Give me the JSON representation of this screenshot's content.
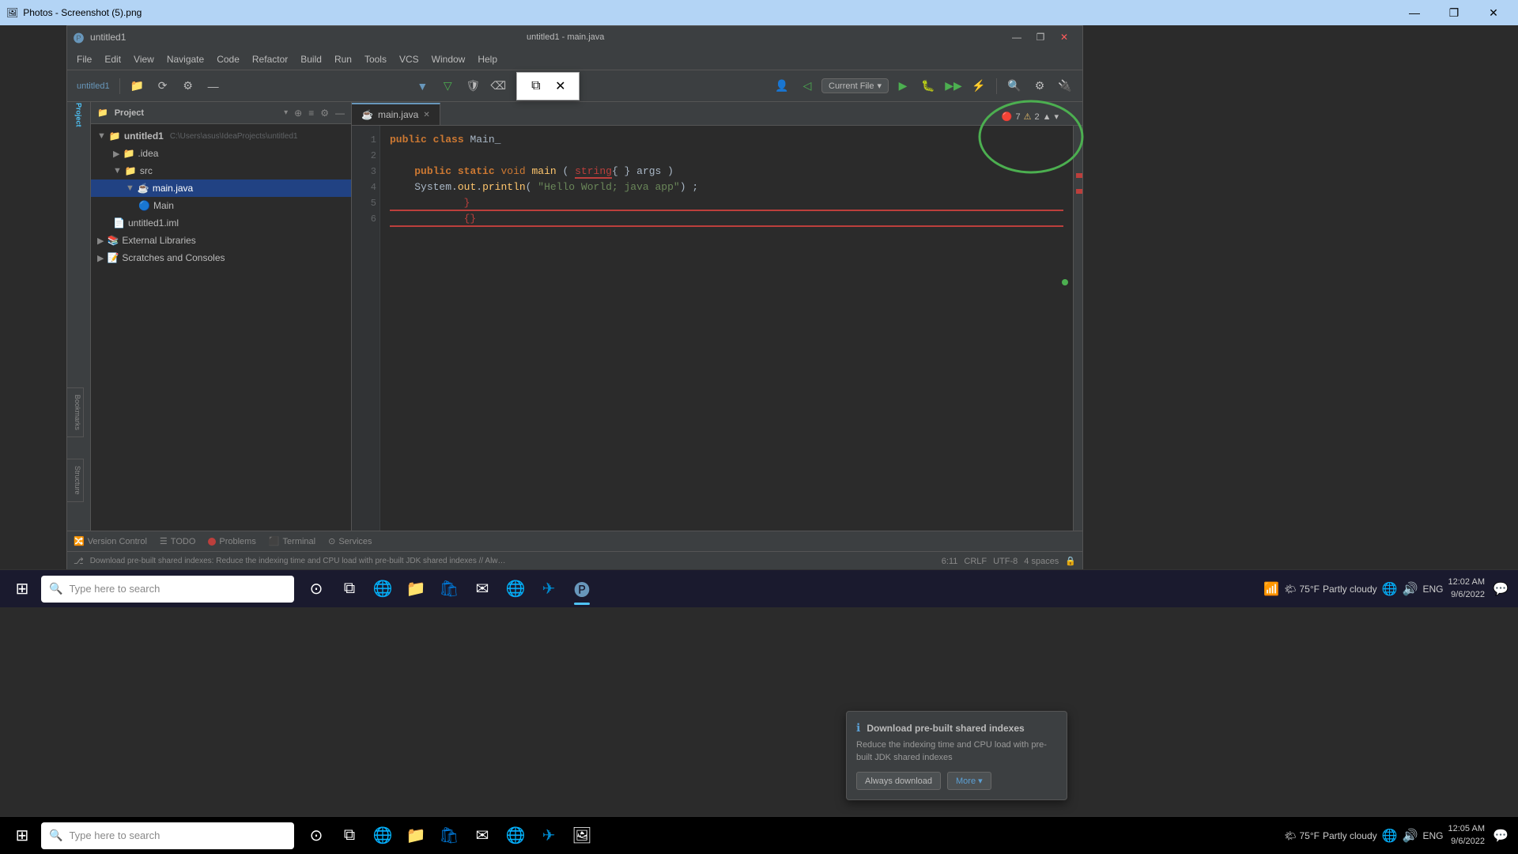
{
  "window": {
    "title": "Photos - Screenshot (5).png",
    "min_btn": "—",
    "max_btn": "❐",
    "close_btn": "✕"
  },
  "ide": {
    "title": "untitled1 - main.java",
    "menu": [
      "File",
      "Edit",
      "View",
      "Navigate",
      "Code",
      "Refactor",
      "Build",
      "Run",
      "Tools",
      "VCS",
      "Window",
      "Help"
    ],
    "project_name": "untitled1",
    "project_path": "C:\\Users\\asus\\IdeaProjects\\untitled1",
    "run_config": "Current File",
    "tab": {
      "name": "main.java",
      "icon": "☕"
    },
    "code_lines": [
      "public class Main_",
      "",
      "    public static void main ( string{ } args )",
      "    System.out.println( \"Hello World; java app\") ;",
      "            }",
      "            {}"
    ],
    "errors": "7",
    "warnings": "2",
    "status": {
      "version_control": "Version Control",
      "todo": "TODO",
      "problems": "Problems",
      "terminal": "Terminal",
      "services": "Services",
      "position": "6:11",
      "line_ending": "CRLF",
      "encoding": "UTF-8",
      "indent": "4 spaces"
    },
    "status_msg": "Download pre-built shared indexes: Reduce the indexing time and CPU load with pre-built JDK shared indexes // Always download // Download once // Don't show again // Configure...",
    "notification": {
      "title": "Download pre-built shared indexes",
      "body": "Reduce the indexing time and CPU load with pre-built JDK shared indexes",
      "btn1": "Always download",
      "btn2": "More ▾"
    }
  },
  "project_tree": [
    {
      "level": 0,
      "label": "Project",
      "icon": "📁",
      "type": "header"
    },
    {
      "level": 0,
      "label": "untitled1",
      "icon": "📁",
      "type": "project",
      "path": "C:\\Users\\asus\\IdeaProjects\\untitled1"
    },
    {
      "level": 1,
      "label": ".idea",
      "icon": "📁",
      "type": "folder"
    },
    {
      "level": 1,
      "label": "src",
      "icon": "📁",
      "type": "folder"
    },
    {
      "level": 2,
      "label": "main.java",
      "icon": "☕",
      "type": "java"
    },
    {
      "level": 3,
      "label": "Main",
      "icon": "🔵",
      "type": "class"
    },
    {
      "level": 1,
      "label": "untitled1.iml",
      "icon": "📄",
      "type": "iml"
    },
    {
      "level": 0,
      "label": "External Libraries",
      "icon": "📚",
      "type": "folder"
    },
    {
      "level": 0,
      "label": "Scratches and Consoles",
      "icon": "📝",
      "type": "folder"
    }
  ],
  "taskbar": {
    "search_placeholder": "Type here to search",
    "weather": "75°F  Partly cloudy",
    "language": "ENG",
    "time": "12:02 AM",
    "date": "9/6/2022"
  },
  "taskbar2": {
    "search_placeholder": "Type here to search",
    "weather": "75°F  Partly cloudy",
    "language": "ENG",
    "time": "12:05 AM",
    "date": "9/6/2022"
  },
  "float_window": {
    "restore_icon": "⧉",
    "close_icon": "✕"
  }
}
